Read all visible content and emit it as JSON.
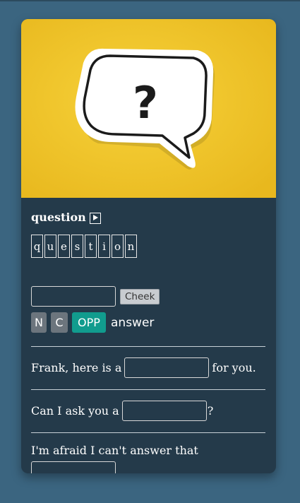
{
  "lesson": {
    "word": "question",
    "letters": [
      "q",
      "u",
      "e",
      "s",
      "t",
      "i",
      "o",
      "n"
    ],
    "answer_input_value": "",
    "check_label": "Cheek",
    "buttons": {
      "n": "N",
      "c": "C",
      "opp": "OPP"
    },
    "answer_label": "answer"
  },
  "hero": {
    "symbol": "?",
    "icon": "speech-bubble-question-icon"
  },
  "sentences": [
    {
      "before": "Frank, here is a",
      "after": "for you."
    },
    {
      "before": "Can I ask you a",
      "after": "?"
    },
    {
      "before": "I'm afraid I can't answer that",
      "after": "."
    }
  ],
  "colors": {
    "page_bg": "#3b6580",
    "card_bg": "#243a4a",
    "hero_bg": "#f0c52a",
    "accent": "#119c8e",
    "neutral_button": "#6c757d"
  }
}
